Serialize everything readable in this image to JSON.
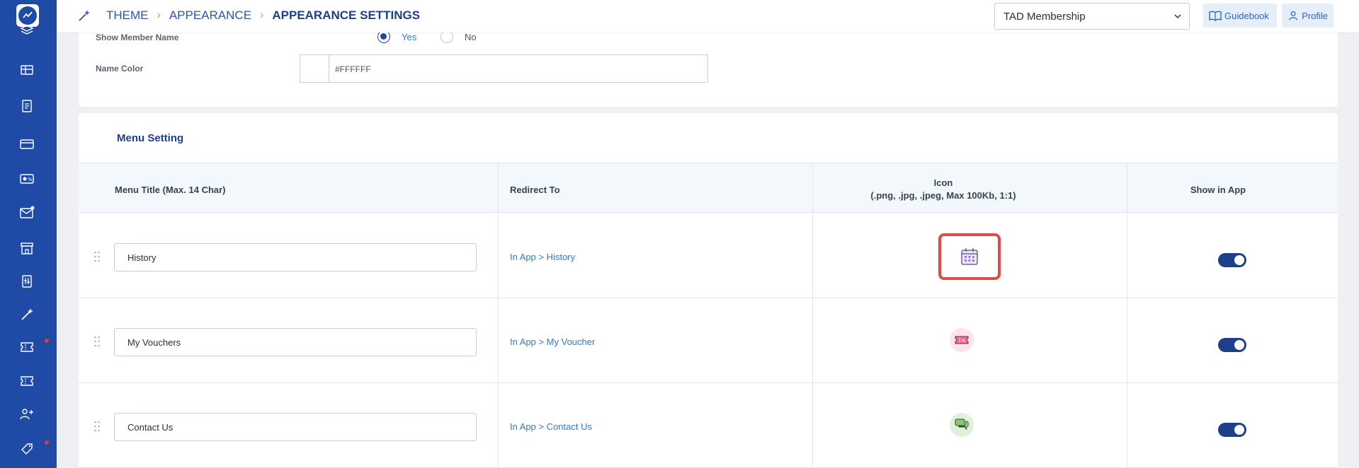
{
  "sidebar": {
    "logo": "chart-logo-icon",
    "items": [
      {
        "icon": "stack-icon"
      },
      {
        "icon": "id-card-icon"
      },
      {
        "icon": "document-icon"
      },
      {
        "icon": "credit-card-icon"
      },
      {
        "icon": "discount-card-icon"
      },
      {
        "icon": "mail-notification-icon",
        "dot": true
      },
      {
        "icon": "store-icon"
      },
      {
        "icon": "settings-doc-icon"
      },
      {
        "icon": "magic-wand-icon"
      },
      {
        "icon": "ticket-icon",
        "dot": true
      },
      {
        "icon": "ticket-icon"
      },
      {
        "icon": "user-add-icon"
      },
      {
        "icon": "tag-icon",
        "dot": true
      }
    ],
    "dot_color": "#e53935"
  },
  "header": {
    "breadcrumb": [
      "THEME",
      "APPEARANCE",
      "APPEARANCE SETTINGS"
    ],
    "membership_select": "TAD Membership",
    "guidebook_label": "Guidebook",
    "profile_label": "Profile"
  },
  "profile_section": {
    "show_member_name_label": "Show Member Name",
    "yes_label": "Yes",
    "no_label": "No",
    "selected": "Yes",
    "name_color_label": "Name Color",
    "name_color_value": "#FFFFFF"
  },
  "menu_setting": {
    "title": "Menu Setting",
    "columns": {
      "menu_title": "Menu Title (Max. 14 Char)",
      "redirect": "Redirect To",
      "icon_line1": "Icon",
      "icon_line2": "(.png, .jpg, .jpeg, Max 100Kb, 1:1)",
      "show": "Show in App"
    },
    "rows": [
      {
        "title": "History",
        "redirect": "In App > History",
        "icon": "calendar-icon",
        "show": true
      },
      {
        "title": "My Vouchers",
        "redirect": "In App > My Voucher",
        "icon": "voucher-icon",
        "show": true
      },
      {
        "title": "Contact Us",
        "redirect": "In App > Contact Us",
        "icon": "chat-icon",
        "show": true
      }
    ]
  },
  "colors": {
    "sidebar": "#1f4aa6",
    "primary": "#1e3f8a",
    "link": "#2d7ad6",
    "highlight": "#e24a4a"
  }
}
